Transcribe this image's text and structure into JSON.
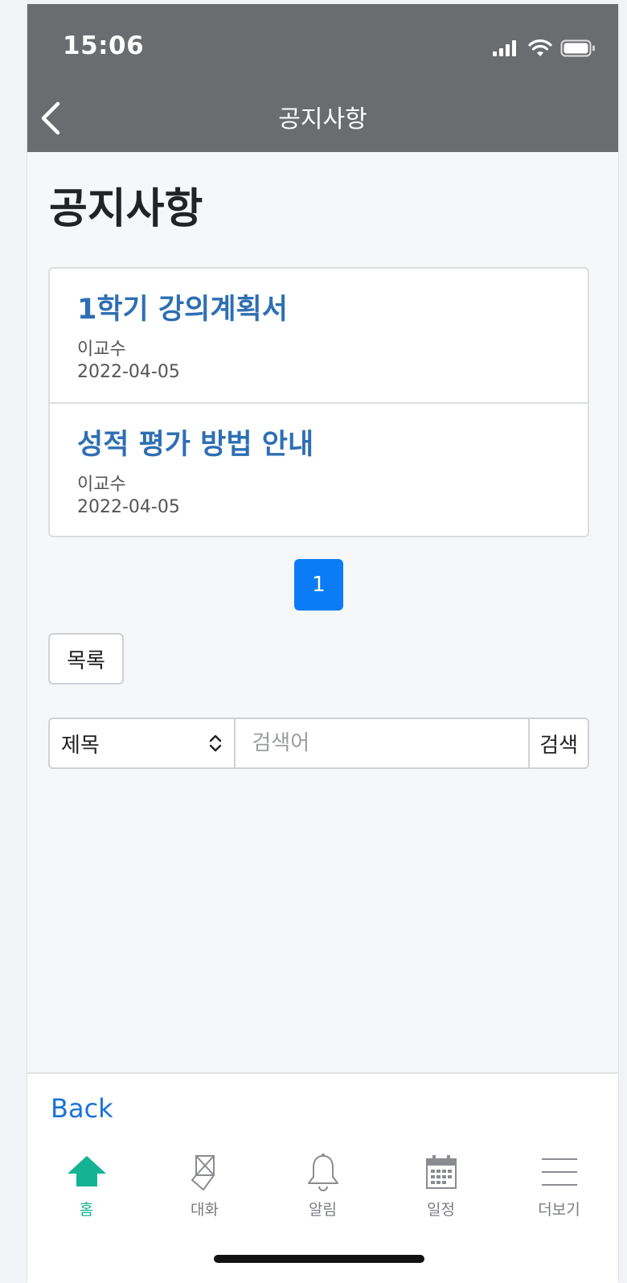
{
  "status_bar": {
    "time": "15:06"
  },
  "nav": {
    "title": "공지사항",
    "back_icon": "chevron-left-icon"
  },
  "page": {
    "title": "공지사항"
  },
  "notices": [
    {
      "title": "1학기 강의계획서",
      "author": "이교수",
      "date": "2022-04-05"
    },
    {
      "title": "성적 평가 방법 안내",
      "author": "이교수",
      "date": "2022-04-05"
    }
  ],
  "pagination": {
    "current_page": "1"
  },
  "list_button": {
    "label": "목록"
  },
  "search": {
    "field_selected": "제목",
    "placeholder": "검색어",
    "button_label": "검색"
  },
  "footer": {
    "back_label": "Back",
    "tabs": [
      {
        "label": "홈",
        "icon": "home-icon",
        "active": true
      },
      {
        "label": "대화",
        "icon": "chat-icon",
        "active": false
      },
      {
        "label": "알림",
        "icon": "bell-icon",
        "active": false
      },
      {
        "label": "일정",
        "icon": "calendar-icon",
        "active": false
      },
      {
        "label": "더보기",
        "icon": "menu-icon",
        "active": false
      }
    ]
  },
  "colors": {
    "header_bg": "#6b6c70",
    "link_title": "#2e6fb3",
    "primary": "#0b7cf5",
    "active_tab": "#14b394"
  }
}
